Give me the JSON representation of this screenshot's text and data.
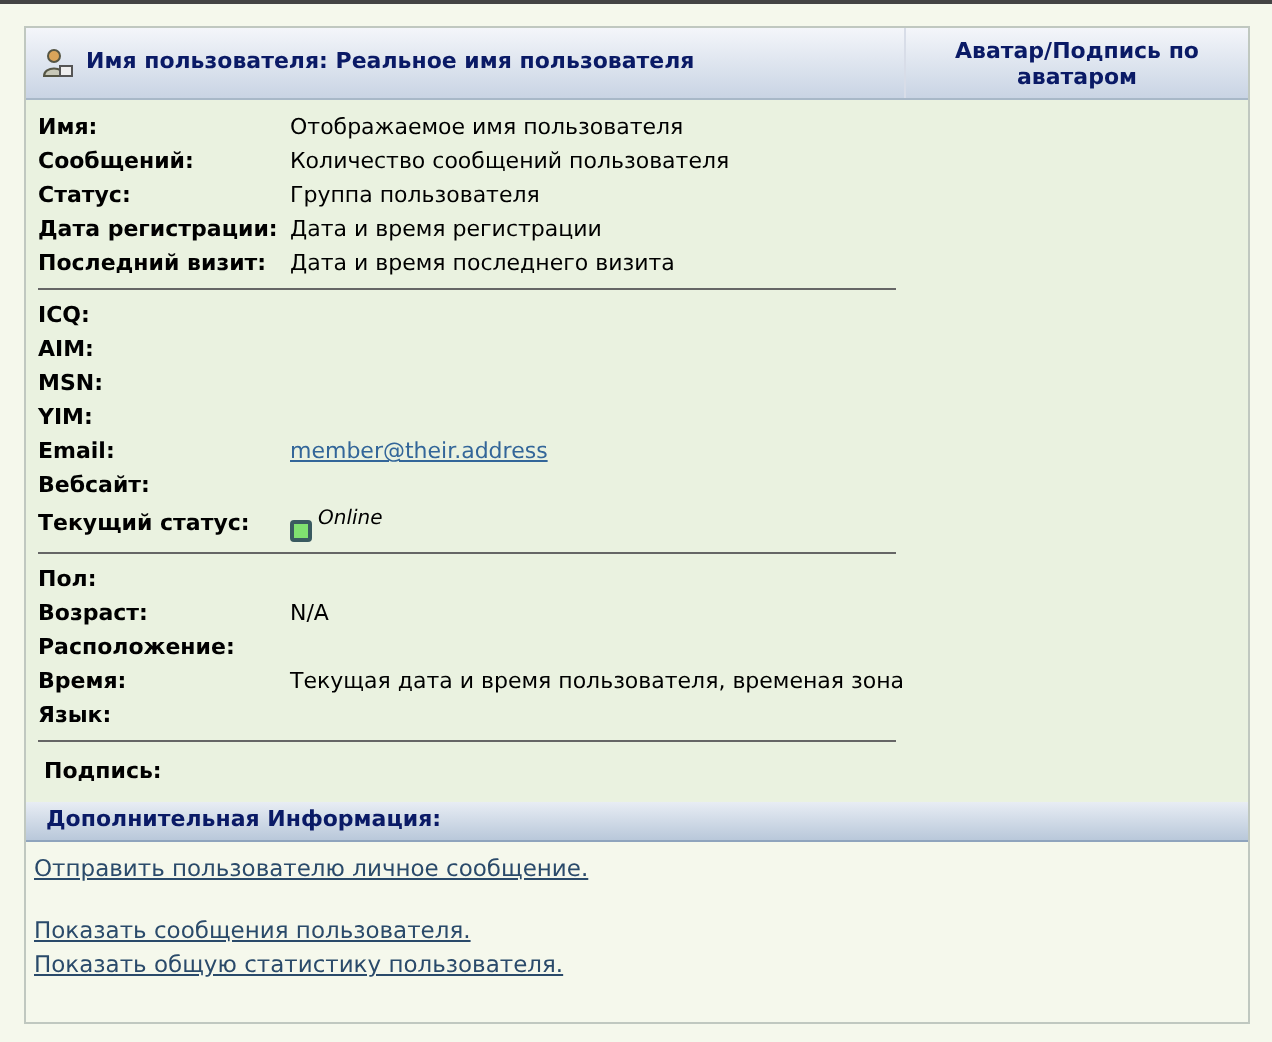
{
  "profile": {
    "title": "Имя пользователя: Реальное имя пользователя",
    "avatar_heading": "Аватар/Подпись по аватаром",
    "groups": [
      [
        {
          "label": "Имя:",
          "value": "Отображаемое имя пользователя",
          "kind": "text"
        },
        {
          "label": "Сообщений:",
          "value": "Количество сообщений пользователя",
          "kind": "text"
        },
        {
          "label": "Статус:",
          "value": "Группа пользователя",
          "kind": "text"
        },
        {
          "label": "Дата регистрации:",
          "value": "Дата и время регистрации",
          "kind": "text"
        },
        {
          "label": "Последний визит:",
          "value": "Дата и время последнего визита",
          "kind": "text"
        }
      ],
      [
        {
          "label": "ICQ:",
          "kind": "text"
        },
        {
          "label": "AIM:",
          "kind": "text"
        },
        {
          "label": "MSN:",
          "kind": "text"
        },
        {
          "label": "YIM:",
          "kind": "text"
        },
        {
          "label": "Email:",
          "value": "member@their.address",
          "kind": "link"
        },
        {
          "label": "Вебсайт:",
          "kind": "text"
        },
        {
          "label": "Текущий статус:",
          "value": "Online",
          "kind": "status",
          "color": "#80e070"
        }
      ],
      [
        {
          "label": "Пол:",
          "kind": "text"
        },
        {
          "label": "Возраст:",
          "value": "N/A",
          "kind": "text"
        },
        {
          "label": "Расположение:",
          "kind": "text"
        },
        {
          "label": "Время:",
          "value": "Текущая дата и время пользователя, временая зона",
          "kind": "text"
        },
        {
          "label": "Язык:",
          "kind": "text"
        }
      ]
    ],
    "signature_label": "Подпись:"
  },
  "extra": {
    "title": "Дополнительная Информация:",
    "link_groups": [
      [
        "Отправить пользователю личное сообщение."
      ],
      [
        "Показать сообщения пользователя.",
        "Показать общую статистику пользователя."
      ]
    ]
  }
}
